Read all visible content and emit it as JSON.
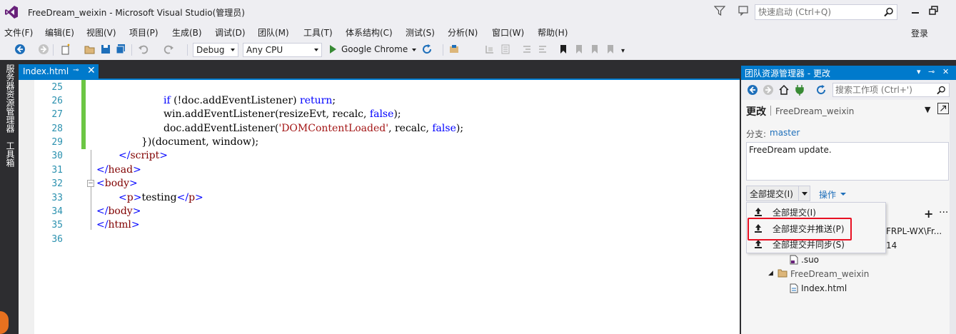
{
  "window": {
    "title": "FreeDream_weixin - Microsoft Visual Studio(管理员)",
    "quick_launch_placeholder": "快速启动 (Ctrl+Q)",
    "login": "登录"
  },
  "menu": [
    "文件(F)",
    "编辑(E)",
    "视图(V)",
    "项目(P)",
    "生成(B)",
    "调试(D)",
    "团队(M)",
    "工具(T)",
    "体系结构(C)",
    "测试(S)",
    "分析(N)",
    "窗口(W)",
    "帮助(H)"
  ],
  "toolbar": {
    "config": "Debug",
    "platform": "Any CPU",
    "browser": "Google Chrome"
  },
  "left_strip": {
    "server_explorer": "服务器资源管理器",
    "toolbox": "工具箱"
  },
  "editor": {
    "tab_label": "Index.html",
    "line_numbers": [
      "25",
      "26",
      "27",
      "28",
      "29",
      "30",
      "31",
      "32",
      "33",
      "34",
      "35",
      "36"
    ],
    "lines": {
      "l26_kw": "if",
      "l26_a": " (!doc.addEventListener) ",
      "l26_ret": "return",
      "l26_b": ";",
      "l27_a": "win.addEventListener(resizeEvt, recalc, ",
      "l27_false": "false",
      "l27_b": ");",
      "l28_a": "doc.addEventListener(",
      "l28_str": "'DOMContentLoaded'",
      "l28_b": ", recalc, ",
      "l28_false": "false",
      "l28_c": ");",
      "l29": "})(document, window);",
      "l30_open": "</",
      "l30_tag": "script",
      "l30_close": ">",
      "l31_open": "</",
      "l31_tag": "head",
      "l31_close": ">",
      "l32_open": "<",
      "l32_tag": "body",
      "l32_close": ">",
      "l33_open": "<",
      "l33_tag": "p",
      "l33_close": ">",
      "l33_text": "testing",
      "l33_end_open": "</",
      "l33_end_tag": "p",
      "l33_end_close": ">",
      "l34_open": "</",
      "l34_tag": "body",
      "l34_close": ">",
      "l35_open": "</",
      "l35_tag": "html",
      "l35_close": ">"
    }
  },
  "team_explorer": {
    "title": "团队资源管理器 - 更改",
    "search_placeholder": "搜索工作项 (Ctrl+')",
    "page_heading": "更改",
    "page_sub": "FreeDream_weixin",
    "branch_label": "分支:",
    "branch": "master",
    "commit_message": "FreeDream update.",
    "commit_button": "全部提交(I)",
    "actions": "操作",
    "dropdown": [
      "全部提交(I)",
      "全部提交并推送(P)",
      "全部提交并同步(S)"
    ],
    "tree_partial_1": "FRPL-WX\\Fr...",
    "tree_partial_2": "14",
    "tree_suo": ".suo",
    "tree_folder": "FreeDream_weixin",
    "tree_file": "Index.html"
  },
  "colors": {
    "accent": "#007acc",
    "highlight_box": "#e81123",
    "change_bar": "#6cc644"
  }
}
